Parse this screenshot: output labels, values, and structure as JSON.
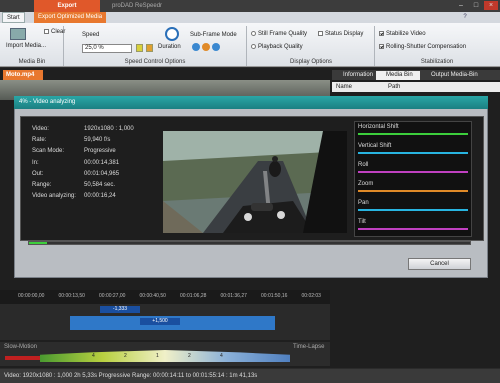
{
  "window": {
    "export_tab": "Export",
    "title": "proDAD ReSpeedr",
    "min_glyph": "–",
    "max_glyph": "□",
    "close_glyph": "×"
  },
  "ribbon": {
    "tabs": [
      "Start",
      "Export Optimized Media"
    ],
    "help_glyph": "?",
    "media_bin": {
      "import_label": "Import Media...",
      "clear_label": "Clear",
      "group_label": "Media Bin"
    },
    "speed": {
      "speed_label": "Speed",
      "speed_value": "25,0 %",
      "duration_label": "Duration",
      "group_label": "Speed Control Options"
    },
    "subframe": {
      "label": "Sub-Frame Mode"
    },
    "display": {
      "still_frame": "Still Frame Quality",
      "status_display": "Status Display",
      "playback_quality": "Playback Quality",
      "group_label": "Display Options"
    },
    "stabilization": {
      "stabilize_video": "Stabilize Video",
      "rolling_shutter": "Rolling-Shutter Compensation",
      "group_label": "Stabilization"
    }
  },
  "file_tab": "Moto.mp4",
  "right_panel": {
    "tabs": [
      "Information",
      "Media Bin",
      "Output Media-Bin"
    ],
    "columns": [
      "Name",
      "Path"
    ]
  },
  "dialog": {
    "title": "4% - Video analyzing",
    "info": [
      {
        "label": "Video:",
        "value": "1920x1080 : 1,000"
      },
      {
        "label": "Rate:",
        "value": "59,940 f/s"
      },
      {
        "label": "Scan Mode:",
        "value": "Progressive"
      },
      {
        "label": "In:",
        "value": "00:00:14,381"
      },
      {
        "label": "Out:",
        "value": "00:01:04,965"
      },
      {
        "label": "Range:",
        "value": "50,584 sec."
      },
      {
        "label": "Video analyzing:",
        "value": "00:00:16,24"
      }
    ],
    "graphs": [
      "Horizontal Shift",
      "Vertical Shift",
      "Roll",
      "Zoom",
      "Pan",
      "Tilt"
    ],
    "graph_colors": [
      "#3ccf3c",
      "#28b4e0",
      "#c040c0",
      "#e08a28",
      "#28b4e0",
      "#c040c0"
    ],
    "progress": 0.04,
    "cancel_label": "Cancel"
  },
  "timeline": {
    "ticks": [
      "00:00:00,00",
      "00:00:13,50",
      "00:00:27,00",
      "00:00:40,50",
      "00:01:06,28",
      "00:01:36,27",
      "00:01:50,16",
      "00:02:03"
    ],
    "badges": [
      "-1,333",
      "+1,500"
    ],
    "slow_motion": "Slow-Motion",
    "time_lapse": "Time-Lapse",
    "speed_marks": [
      "4",
      "2",
      "1",
      "2",
      "4"
    ]
  },
  "status": {
    "text": "Video: 1920x1080 : 1,000   2h 5,33s   Progressive   Range: 00:00:14:11 to 00:01:55:14 : 1m 41,13s"
  }
}
